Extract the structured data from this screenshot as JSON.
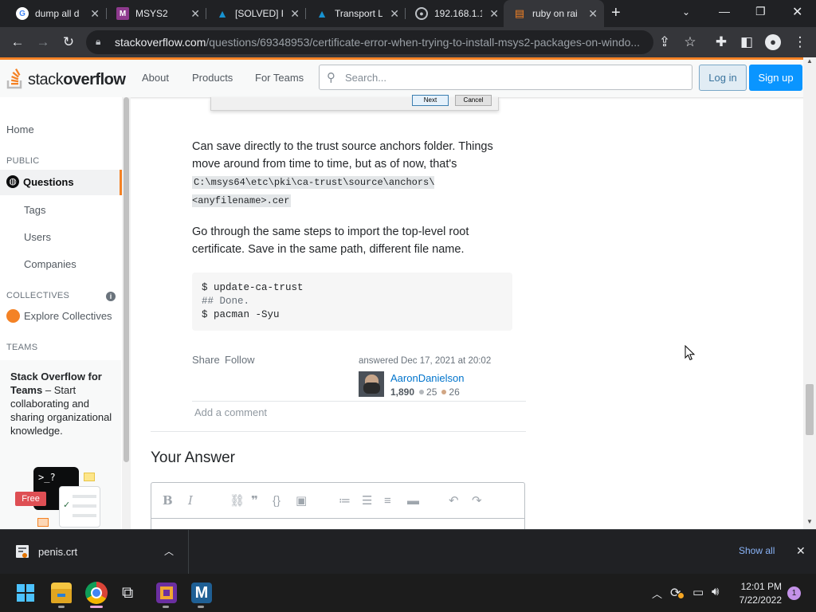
{
  "browser": {
    "tabs": [
      {
        "title": "dump all d",
        "favicon": "google-icon",
        "active": false
      },
      {
        "title": "MSYS2",
        "favicon": "msys2-icon",
        "active": false
      },
      {
        "title": "[SOLVED] P",
        "favicon": "arch-icon",
        "active": false
      },
      {
        "title": "Transport L",
        "favicon": "arch-icon",
        "active": false
      },
      {
        "title": "192.168.1.1",
        "favicon": "globe-icon",
        "active": false
      },
      {
        "title": "ruby on rai",
        "favicon": "stackoverflow-icon",
        "active": true
      }
    ],
    "url_host": "stackoverflow.com",
    "url_path": "/questions/69348953/certificate-error-when-trying-to-install-msys2-packages-on-windo..."
  },
  "so_header": {
    "logo_text_light": "stack",
    "logo_text_bold": "overflow",
    "nav": [
      "About",
      "Products",
      "For Teams"
    ],
    "search_placeholder": "Search...",
    "login_label": "Log in",
    "signup_label": "Sign up"
  },
  "sidebar": {
    "home": "Home",
    "public_heading": "PUBLIC",
    "questions": "Questions",
    "tags": "Tags",
    "users": "Users",
    "companies": "Companies",
    "collectives_heading": "COLLECTIVES",
    "explore_collectives": "Explore Collectives",
    "teams_heading": "TEAMS",
    "teams_title": "Stack Overflow for Teams",
    "teams_desc": "– Start collaborating and sharing organizational knowledge.",
    "free_badge": "Free"
  },
  "dialog_fragment": {
    "next": "Next",
    "cancel": "Cancel"
  },
  "answer": {
    "para1": "Can save directly to the trust source anchors folder. Things move around from time to time, but as of now, that's",
    "code_prefix": "C:",
    "code_selected": "\\msys64\\etc\\pki\\ca-trust\\source\\anchors\\",
    "code_suffix": "<anyfilename>.cer",
    "para2": "Go through the same steps to import the top-level root certificate. Save in the same path, different file name.",
    "code_lines": [
      "$ update-ca-trust",
      "## Done.",
      "$ pacman -Syu"
    ],
    "share": "Share",
    "follow": "Follow",
    "answered": "answered Dec 17, 2021 at 20:02",
    "user": "AaronDanielson",
    "reputation": "1,890",
    "silver": "25",
    "bronze": "26",
    "add_comment": "Add a comment"
  },
  "your_answer": {
    "title": "Your Answer",
    "toolbar_icons": [
      "bold-icon",
      "italic-icon",
      "link-icon",
      "quote-icon",
      "code-icon",
      "image-icon",
      "ordered-list-icon",
      "bullet-list-icon",
      "heading-icon",
      "rule-icon",
      "undo-icon",
      "redo-icon"
    ]
  },
  "download_bar": {
    "filename": "penis.crt",
    "show_all": "Show all"
  },
  "taskbar": {
    "time": "12:01 PM",
    "date": "7/22/2022",
    "notification_count": "1"
  },
  "colors": {
    "so_orange": "#f48225",
    "so_blue": "#0a95ff",
    "link_blue": "#0074cc",
    "selection_blue": "#1a73e8"
  }
}
